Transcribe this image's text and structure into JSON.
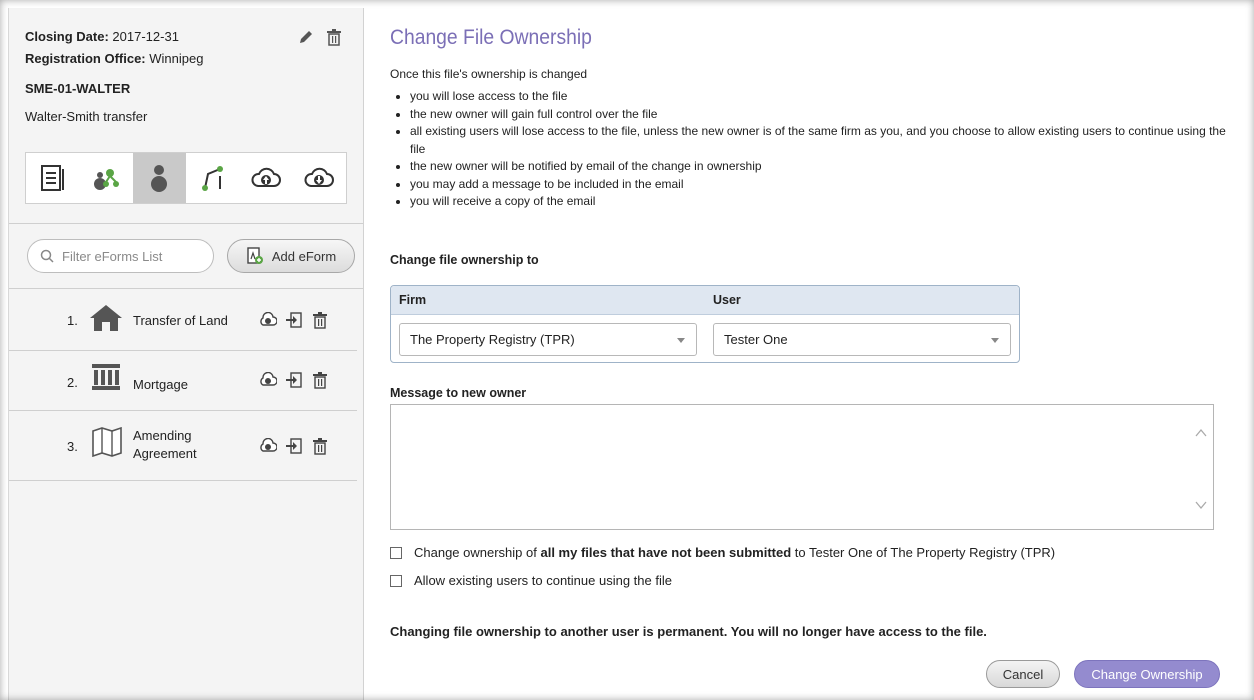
{
  "file": {
    "closing_date_label": "Closing Date:",
    "closing_date": "2017-12-31",
    "registration_office_label": "Registration Office:",
    "registration_office": "Winnipeg",
    "reference": "SME-01-WALTER",
    "description": "Walter-Smith transfer"
  },
  "toolbar": {
    "items": [
      "document-icon",
      "parties-icon",
      "user-icon",
      "workflow-icon",
      "cloud-upload-icon",
      "cloud-download-icon"
    ],
    "active": "user-icon"
  },
  "eforms": {
    "filter_placeholder": "Filter eForms List",
    "add_label": "Add eForm",
    "items": [
      {
        "num": "1.",
        "name": "Transfer of Land",
        "icon": "house-icon"
      },
      {
        "num": "2.",
        "name": "Mortgage",
        "icon": "bank-icon"
      },
      {
        "num": "3.",
        "name": "Amending Agreement",
        "icon": "map-icon"
      }
    ]
  },
  "main": {
    "title": "Change File Ownership",
    "intro": "Once this file's ownership is changed",
    "bullets": [
      "you will lose access to the file",
      "the new owner will gain full control over the file",
      "all existing users will lose access to the file, unless the new owner is of the same firm as you, and you choose to allow existing users to continue using the file",
      "the new owner will be notified by email of the change in ownership",
      "you may add a message to be included in the email",
      "you will receive a copy of the email"
    ],
    "change_to_label": "Change file ownership to",
    "firm_header": "Firm",
    "user_header": "User",
    "firm_value": "The Property Registry (TPR)",
    "user_value": "Tester One",
    "message_label": "Message to new owner",
    "message_value": "",
    "check_all_pre": "Change ownership of ",
    "check_all_bold": "all my files that have not been submitted",
    "check_all_post": " to Tester One of The Property Registry (TPR)",
    "check_allow": "Allow existing users to continue using the file",
    "warning": "Changing file ownership to another user is permanent. You will no longer have access to the file.",
    "cancel_label": "Cancel",
    "submit_label": "Change Ownership"
  },
  "colors": {
    "accent": "#7b6fb6",
    "primary_button": "#948bcf",
    "table_header": "#dfe7f1"
  }
}
